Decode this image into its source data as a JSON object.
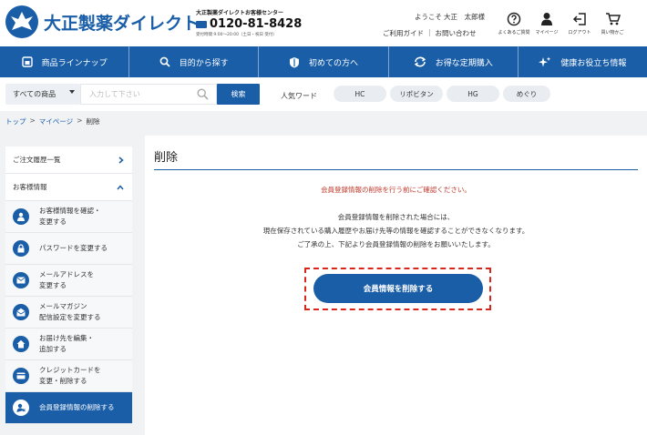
{
  "header": {
    "logo_text": "大正製薬ダイレクト",
    "call_center": {
      "title": "大正製薬ダイレクトお客様センター",
      "phone": "0120-81-8428",
      "hours": "受付時間 9:00〜20:00（土日・祝日 受付）"
    },
    "welcome": {
      "prefix": "ようこそ",
      "name": "大正　太郎様"
    },
    "links": [
      "ご利用ガイド",
      "お問い合わせ"
    ],
    "icons": [
      {
        "icon": "question-circle-icon",
        "label": "よくあるご質問"
      },
      {
        "icon": "person-icon",
        "label": "マイページ"
      },
      {
        "icon": "logout-icon",
        "label": "ログアウト"
      },
      {
        "icon": "cart-icon",
        "label": "買い物かご"
      }
    ]
  },
  "nav": {
    "items": [
      {
        "icon": "bottle-icon",
        "label": "商品ラインナップ"
      },
      {
        "icon": "search-icon",
        "label": "目的から探す"
      },
      {
        "icon": "shield-icon",
        "label": "初めての方へ"
      },
      {
        "icon": "refresh-icon",
        "label": "お得な定期購入"
      },
      {
        "icon": "sparkle-icon",
        "label": "健康お役立ち情報"
      }
    ]
  },
  "search": {
    "category": "すべての商品",
    "placeholder": "入力して下さい",
    "button": "検索",
    "keywords_label": "人気ワード",
    "keywords": [
      "HC",
      "リポビタン",
      "HG",
      "めぐり"
    ]
  },
  "breadcrumb": [
    "トップ",
    "マイページ",
    "削除"
  ],
  "sidebar": {
    "sections": [
      {
        "label": "ご注文履歴一覧",
        "state": "collapsed"
      },
      {
        "label": "お客様情報",
        "state": "expanded"
      }
    ],
    "items": [
      {
        "icon": "person-icon",
        "label": "お客様情報を確認・\n変更する"
      },
      {
        "icon": "lock-icon",
        "label": "パスワードを変更する"
      },
      {
        "icon": "mail-icon",
        "label": "メールアドレスを\n変更する"
      },
      {
        "icon": "newsletter-icon",
        "label": "メールマガジン\n配信設定を変更する"
      },
      {
        "icon": "home-icon",
        "label": "お届け先を編集・\n追加する"
      },
      {
        "icon": "credit-card-icon",
        "label": "クレジットカードを\n変更・削除する"
      },
      {
        "icon": "delete-user-icon",
        "label": "会員登録情報の削除する",
        "active": true
      }
    ]
  },
  "main": {
    "title": "削除",
    "warning": "会員登録情報の削除を行う前にご確認ください。",
    "messages": [
      "会員登録情報を削除された場合には、",
      "現在保存されている購入履歴やお届け先等の情報を確認することができなくなります。",
      "ご了承の上、下記より会員登録情報の削除をお願いいたします。"
    ],
    "delete_button": "会員情報を削除する"
  },
  "colors": {
    "brand": "#1a5ea8",
    "warning": "#c0392b",
    "highlight": "#d9261c",
    "band": "#f1f2f4"
  }
}
